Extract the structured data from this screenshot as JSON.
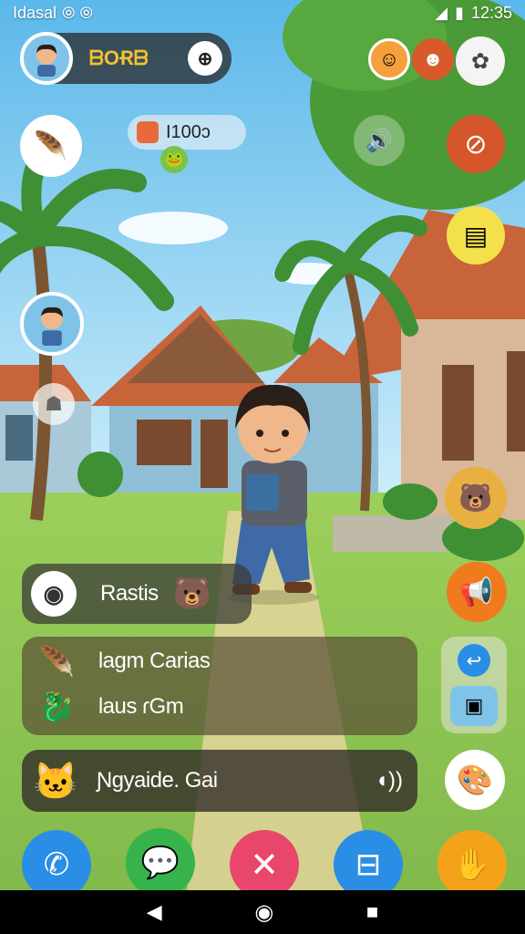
{
  "status_bar": {
    "left_text": "Idasal",
    "right_time": "12:35"
  },
  "profile": {
    "currency_value": "ᗷOɌᗷ"
  },
  "notification": {
    "count_text": "I100ɔ"
  },
  "chat_item": {
    "label": "Rastis"
  },
  "menu_panel": {
    "items": [
      {
        "label": "Ɩagm Carias",
        "icon": "feather-icon"
      },
      {
        "label": "Ɩaus ɾGm",
        "icon": "dragon-icon"
      }
    ]
  },
  "player_bar": {
    "label": "Ɲgyaide. Gai"
  },
  "dock": {
    "colors": [
      "#2a8de6",
      "#36b34a",
      "#e8466a",
      "#2a8de6",
      "#f5a21b"
    ]
  }
}
